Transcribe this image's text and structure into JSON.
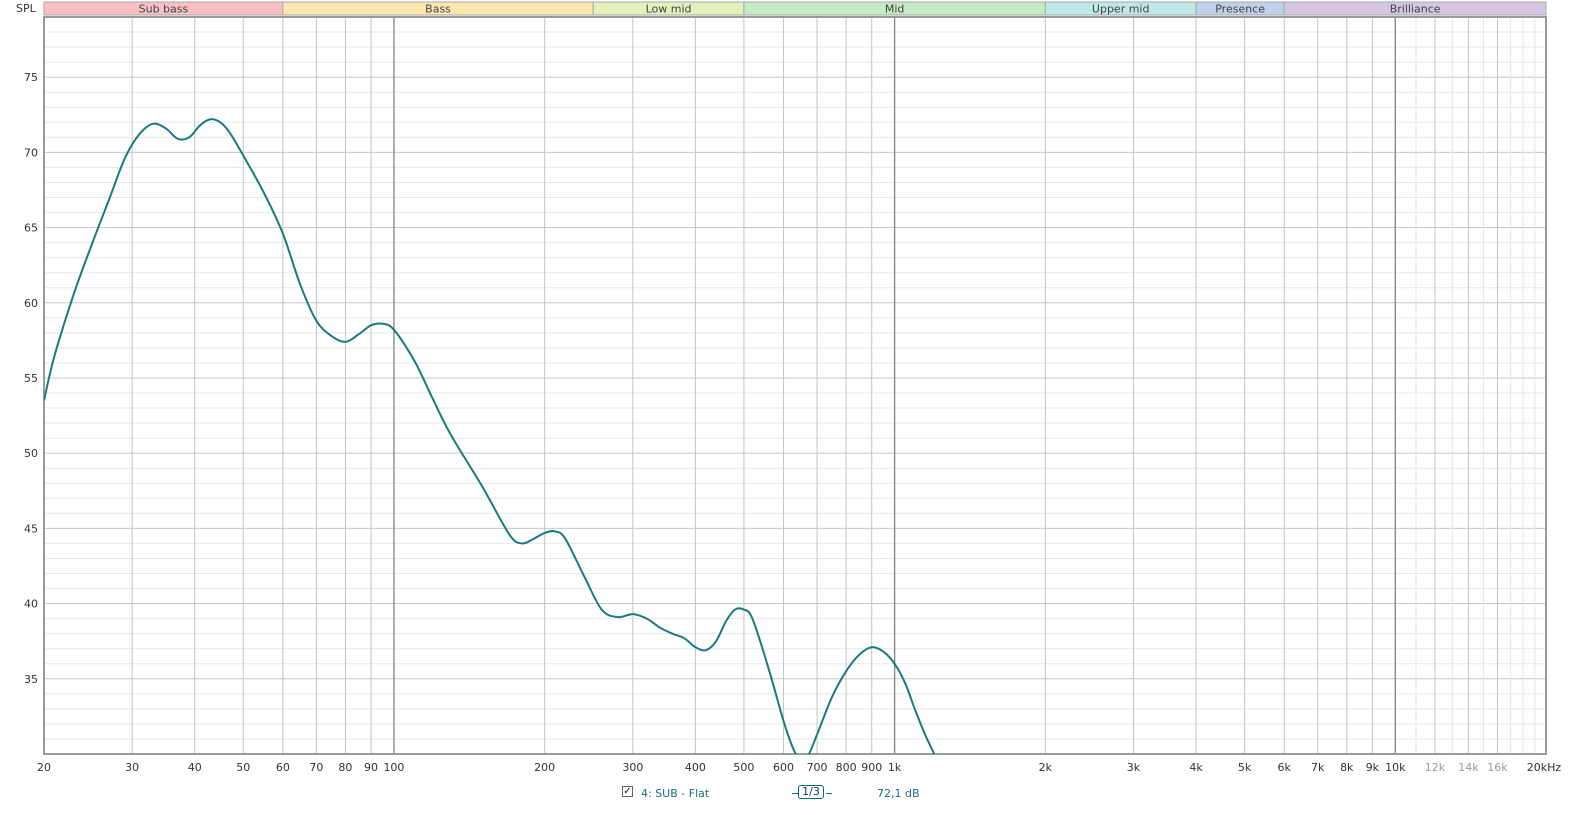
{
  "chart_data": {
    "type": "line",
    "ylabel": "SPL",
    "x_scale": "log",
    "xlim": [
      20,
      20000
    ],
    "ylim": [
      30,
      79
    ],
    "y_ticks": [
      35,
      40,
      45,
      50,
      55,
      60,
      65,
      70,
      75
    ],
    "y_tick_labels": [
      "35",
      "40",
      "45",
      "50",
      "55",
      "60",
      "65",
      "70",
      "75"
    ],
    "x_ticks": [
      20,
      30,
      40,
      50,
      60,
      70,
      80,
      90,
      100,
      200,
      300,
      400,
      500,
      600,
      700,
      800,
      900,
      1000,
      2000,
      3000,
      4000,
      5000,
      6000,
      7000,
      8000,
      9000,
      10000,
      12000,
      14000,
      16000,
      20000
    ],
    "x_tick_labels": [
      "20",
      "30",
      "40",
      "50",
      "60",
      "70",
      "80",
      "90",
      "100",
      "200",
      "300",
      "400",
      "500",
      "600",
      "700",
      "800",
      "900",
      "1k",
      "2k",
      "3k",
      "4k",
      "5k",
      "6k",
      "7k",
      "8k",
      "9k",
      "10k",
      "12k",
      "14k",
      "16k",
      "20kHz"
    ],
    "bands": [
      {
        "label": "Sub bass",
        "from": 20,
        "to": 60,
        "color": "#f9c0c4"
      },
      {
        "label": "Bass",
        "from": 60,
        "to": 250,
        "color": "#fbe6b0"
      },
      {
        "label": "Low mid",
        "from": 250,
        "to": 500,
        "color": "#e5f1bd"
      },
      {
        "label": "Mid",
        "from": 500,
        "to": 2000,
        "color": "#c3ebc4"
      },
      {
        "label": "Upper mid",
        "from": 2000,
        "to": 4000,
        "color": "#bfe9e6"
      },
      {
        "label": "Presence",
        "from": 4000,
        "to": 6000,
        "color": "#bfd2ec"
      },
      {
        "label": "Brilliance",
        "from": 6000,
        "to": 20000,
        "color": "#d5c6e3"
      }
    ],
    "grid": true,
    "series": [
      {
        "name": "4: SUB - Flat",
        "color": "#1a7a80",
        "x": [
          20,
          21,
          23,
          25,
          27,
          29,
          31,
          33,
          35,
          37,
          39,
          41,
          43,
          45,
          47,
          50,
          55,
          60,
          65,
          70,
          75,
          80,
          85,
          90,
          95,
          100,
          110,
          120,
          130,
          150,
          170,
          180,
          190,
          200,
          210,
          220,
          240,
          260,
          280,
          300,
          320,
          340,
          360,
          380,
          400,
          420,
          440,
          460,
          480,
          500,
          520,
          560,
          600,
          630,
          650,
          670,
          700,
          750,
          800,
          850,
          900,
          950,
          1000,
          1050,
          1100,
          1150,
          1200
        ],
        "y": [
          53.5,
          56.5,
          60.7,
          64.0,
          66.9,
          69.6,
          71.2,
          71.9,
          71.6,
          70.9,
          71.0,
          71.8,
          72.2,
          72.0,
          71.3,
          69.8,
          67.3,
          64.6,
          61.2,
          58.8,
          57.8,
          57.4,
          57.9,
          58.5,
          58.6,
          58.2,
          56.1,
          53.5,
          51.2,
          47.8,
          44.6,
          44.0,
          44.3,
          44.7,
          44.8,
          44.3,
          41.8,
          39.6,
          39.1,
          39.3,
          39.0,
          38.4,
          38.0,
          37.7,
          37.1,
          36.9,
          37.5,
          38.8,
          39.6,
          39.6,
          39.0,
          35.7,
          32.2,
          30.2,
          29.6,
          29.8,
          31.3,
          33.8,
          35.5,
          36.6,
          37.1,
          36.8,
          36.0,
          34.7,
          32.9,
          31.3,
          30.0
        ]
      }
    ]
  },
  "legend": {
    "check_mark": "✓",
    "series_label": "4: SUB - Flat",
    "smoothing": "1/3",
    "cursor_value": "72,1 dB"
  },
  "colors": {
    "background": "#ffffff",
    "grid_minor": "#dcdcdc",
    "grid_major": "#8a8a8a",
    "trace": "#1a7a80",
    "frame": "#9a9a9a"
  }
}
